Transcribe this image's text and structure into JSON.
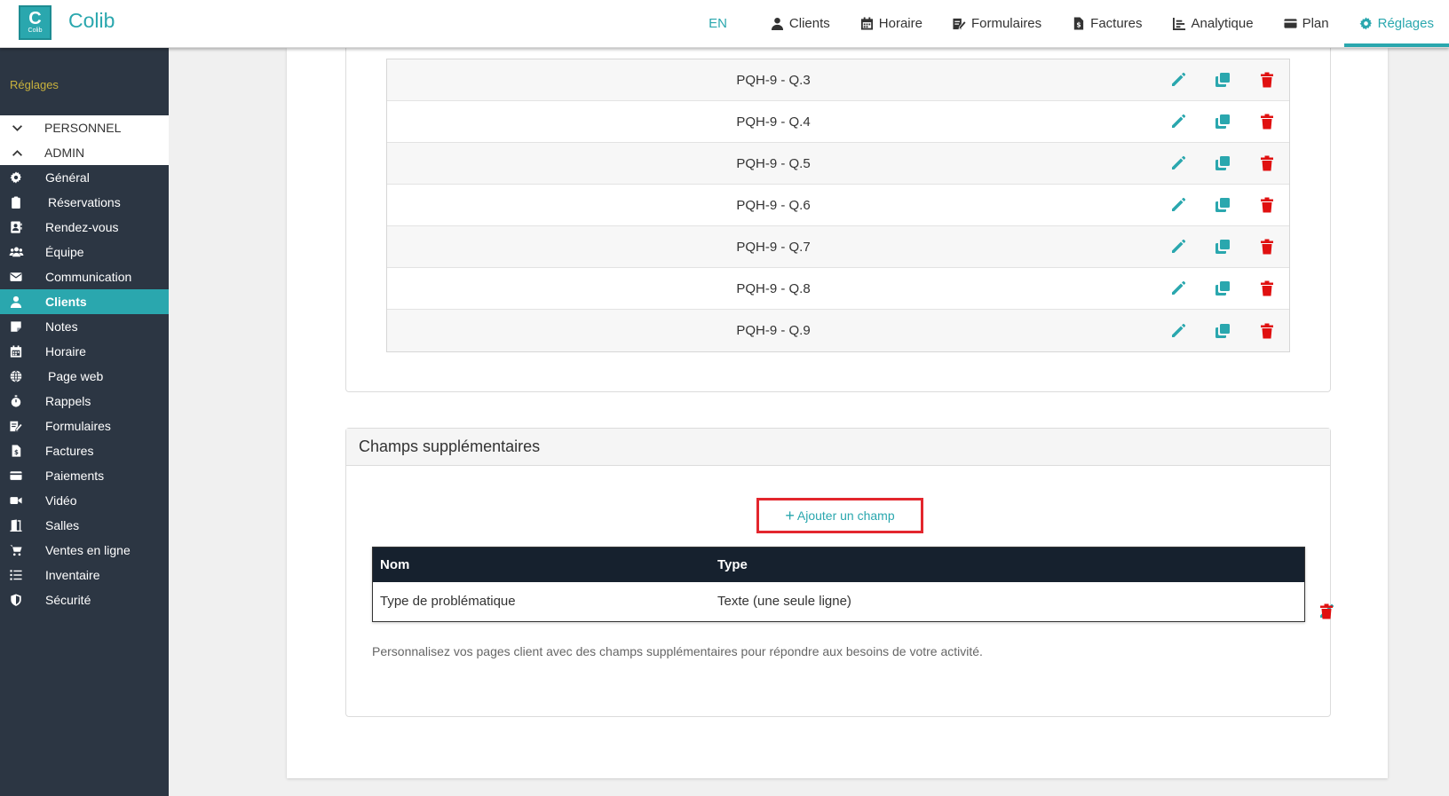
{
  "app": {
    "name": "Colib",
    "logo_letter": "C",
    "logo_sub": "Colib"
  },
  "nav": {
    "lang": "EN",
    "items": [
      {
        "label": "Clients",
        "icon": "user-icon"
      },
      {
        "label": "Horaire",
        "icon": "calendar-icon"
      },
      {
        "label": "Formulaires",
        "icon": "form-edit-icon"
      },
      {
        "label": "Factures",
        "icon": "invoice-icon"
      },
      {
        "label": "Analytique",
        "icon": "chart-icon"
      },
      {
        "label": "Plan",
        "icon": "card-icon"
      },
      {
        "label": "Réglages",
        "icon": "gear-icon",
        "active": true
      }
    ]
  },
  "sidebar": {
    "title": "Réglages",
    "groups": [
      {
        "label": "PERSONNEL",
        "state": "collapsed"
      },
      {
        "label": "ADMIN",
        "state": "expanded"
      }
    ],
    "items": [
      {
        "label": "Général",
        "icon": "gear-icon"
      },
      {
        "label": "Réservations",
        "icon": "clipboard-icon"
      },
      {
        "label": "Rendez-vous",
        "icon": "contact-card-icon"
      },
      {
        "label": "Équipe",
        "icon": "team-icon"
      },
      {
        "label": "Communication",
        "icon": "envelope-icon"
      },
      {
        "label": "Clients",
        "icon": "user-icon",
        "active": true
      },
      {
        "label": "Notes",
        "icon": "note-icon"
      },
      {
        "label": "Horaire",
        "icon": "calendar-icon"
      },
      {
        "label": "Page web",
        "icon": "globe-icon"
      },
      {
        "label": "Rappels",
        "icon": "stopwatch-icon"
      },
      {
        "label": "Formulaires",
        "icon": "form-edit-icon"
      },
      {
        "label": "Factures",
        "icon": "invoice-icon"
      },
      {
        "label": "Paiements",
        "icon": "credit-card-icon"
      },
      {
        "label": "Vidéo",
        "icon": "video-icon"
      },
      {
        "label": "Salles",
        "icon": "door-icon"
      },
      {
        "label": "Ventes en ligne",
        "icon": "cart-icon"
      },
      {
        "label": "Inventaire",
        "icon": "list-icon"
      },
      {
        "label": "Sécurité",
        "icon": "shield-icon"
      }
    ]
  },
  "questions": [
    "PQH-9 - Q.3",
    "PQH-9 - Q.4",
    "PQH-9 - Q.5",
    "PQH-9 - Q.6",
    "PQH-9 - Q.7",
    "PQH-9 - Q.8",
    "PQH-9 - Q.9"
  ],
  "extra_fields": {
    "title": "Champs supplémentaires",
    "add_button": "Ajouter un champ",
    "columns": [
      "Nom",
      "Type"
    ],
    "rows": [
      {
        "name": "Type de problématique",
        "type": "Texte (une seule ligne)"
      }
    ],
    "hint": "Personnalisez vos pages client avec des champs supplémentaires pour répondre aux besoins de votre activité."
  },
  "colors": {
    "accent": "#2aa7ae",
    "danger": "#e01010",
    "sidebar": "#2c3643",
    "sidebar_title": "#c9b23d",
    "table_head": "#16212e",
    "highlight": "#e3262d"
  }
}
